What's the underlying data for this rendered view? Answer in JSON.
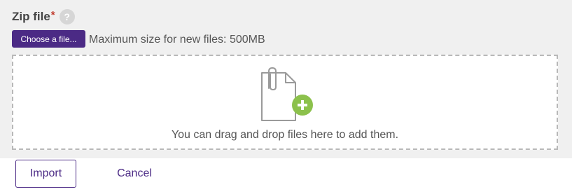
{
  "field": {
    "label": "Zip file",
    "required_marker": "*",
    "help_icon": "question-mark-icon"
  },
  "picker": {
    "button_label": "Choose a file...",
    "max_size_text": "Maximum size for new files: 500MB"
  },
  "dropzone": {
    "icon": "file-add-icon",
    "text": "You can drag and drop files here to add them."
  },
  "actions": {
    "import_label": "Import",
    "cancel_label": "Cancel"
  },
  "colors": {
    "accent": "#4b2a85",
    "add_badge": "#8cc14c",
    "panel_background": "#f0f0f0",
    "required": "#c0392b"
  }
}
